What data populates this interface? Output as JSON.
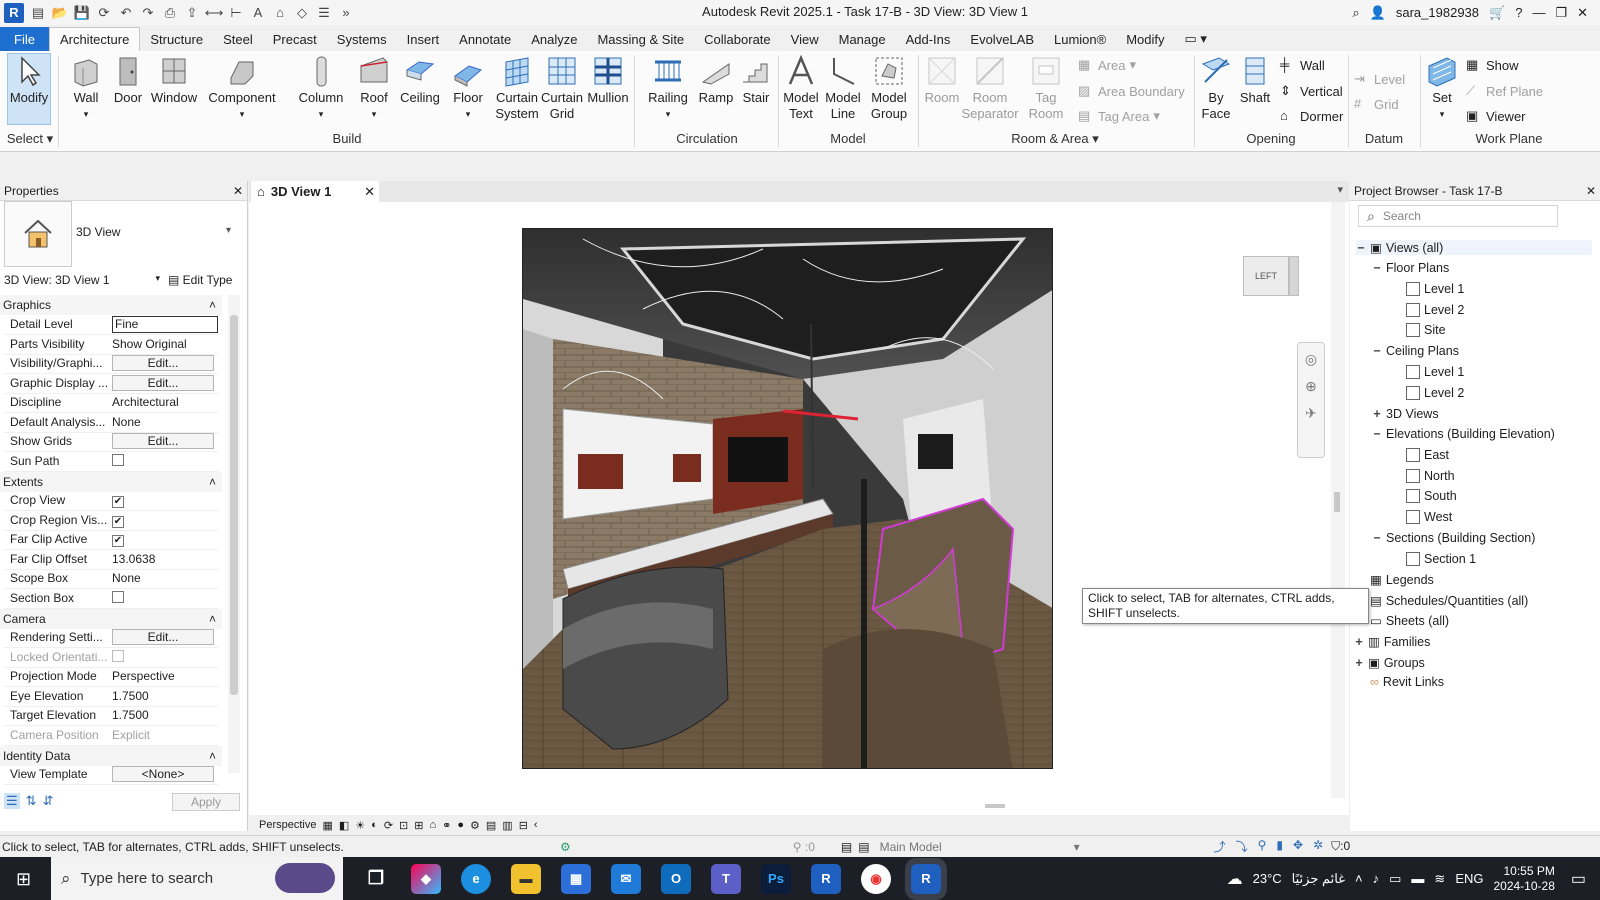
{
  "app": {
    "title": "Autodesk Revit 2025.1 - Task 17-B - 3D View: 3D View 1",
    "user": "sara_1982938"
  },
  "ribbon_tabs": [
    "File",
    "Architecture",
    "Structure",
    "Steel",
    "Precast",
    "Systems",
    "Insert",
    "Annotate",
    "Analyze",
    "Massing & Site",
    "Collaborate",
    "View",
    "Manage",
    "Add-Ins",
    "EvolveLAB",
    "Lumion®",
    "Modify"
  ],
  "ribbon": {
    "select": {
      "modify": "Modify",
      "select_label": "Select"
    },
    "build": {
      "label": "Build",
      "wall": "Wall",
      "door": "Door",
      "window": "Window",
      "component": "Component",
      "column": "Column",
      "roof": "Roof",
      "ceiling": "Ceiling",
      "floor": "Floor",
      "curtain_system": "Curtain\nSystem",
      "curtain_grid": "Curtain\nGrid",
      "mullion": "Mullion"
    },
    "circulation": {
      "label": "Circulation",
      "railing": "Railing",
      "ramp": "Ramp",
      "stair": "Stair"
    },
    "model": {
      "label": "Model",
      "model_text": "Model\nText",
      "model_line": "Model\nLine",
      "model_group": "Model\nGroup"
    },
    "room_area": {
      "label": "Room & Area",
      "room": "Room",
      "room_separator": "Room\nSeparator",
      "tag_room": "Tag\nRoom",
      "area": "Area",
      "area_boundary": "Area  Boundary",
      "tag_area": "Tag  Area"
    },
    "opening": {
      "label": "Opening",
      "by_face": "By\nFace",
      "shaft": "Shaft",
      "wall": "Wall",
      "vertical": "Vertical",
      "dormer": "Dormer"
    },
    "datum": {
      "label": "Datum",
      "level": "Level",
      "grid": "Grid"
    },
    "work_plane": {
      "label": "Work Plane",
      "set": "Set",
      "show": "Show",
      "ref_plane": "Ref  Plane",
      "viewer": "Viewer"
    }
  },
  "properties": {
    "title": "Properties",
    "type_name": "3D View",
    "instance": "3D View: 3D View 1",
    "edit_type": "Edit Type",
    "groups": {
      "graphics": "Graphics",
      "extents": "Extents",
      "camera": "Camera",
      "identity": "Identity Data"
    },
    "rows": {
      "detail_level": {
        "k": "Detail Level",
        "v": "Fine"
      },
      "parts_visibility": {
        "k": "Parts Visibility",
        "v": "Show Original"
      },
      "visibility_graphics": {
        "k": "Visibility/Graphi...",
        "v": "Edit..."
      },
      "graphic_display": {
        "k": "Graphic Display ...",
        "v": "Edit..."
      },
      "discipline": {
        "k": "Discipline",
        "v": "Architectural"
      },
      "default_analysis": {
        "k": "Default Analysis...",
        "v": "None"
      },
      "show_grids": {
        "k": "Show Grids",
        "v": "Edit..."
      },
      "sun_path": {
        "k": "Sun Path",
        "checked": false
      },
      "crop_view": {
        "k": "Crop View",
        "checked": true
      },
      "crop_region_vis": {
        "k": "Crop Region Vis...",
        "checked": true
      },
      "far_clip_active": {
        "k": "Far Clip Active",
        "checked": true
      },
      "far_clip_offset": {
        "k": "Far Clip Offset",
        "v": "13.0638"
      },
      "scope_box": {
        "k": "Scope Box",
        "v": "None"
      },
      "section_box": {
        "k": "Section Box",
        "checked": false
      },
      "rendering_settings": {
        "k": "Rendering Setti...",
        "v": "Edit..."
      },
      "locked_orientation": {
        "k": "Locked Orientati...",
        "checked": false
      },
      "projection_mode": {
        "k": "Projection Mode",
        "v": "Perspective"
      },
      "eye_elevation": {
        "k": "Eye Elevation",
        "v": "1.7500"
      },
      "target_elevation": {
        "k": "Target Elevation",
        "v": "1.7500"
      },
      "camera_position": {
        "k": "Camera Position",
        "v": "Explicit"
      },
      "view_template": {
        "k": "View Template",
        "v": "<None>"
      }
    },
    "apply": "Apply"
  },
  "view": {
    "tab": "3D View 1",
    "viewcube_face": "LEFT",
    "projection_label": "Perspective"
  },
  "browser": {
    "title": "Project Browser - Task 17-B",
    "search_placeholder": "Search",
    "views_all": "Views (all)",
    "floor_plans": "Floor Plans",
    "fp_level1": "Level 1",
    "fp_level2": "Level 2",
    "fp_site": "Site",
    "ceiling_plans": "Ceiling Plans",
    "cp_level1": "Level 1",
    "cp_level2": "Level 2",
    "views_3d": "3D Views",
    "elevations": "Elevations (Building Elevation)",
    "east": "East",
    "north": "North",
    "south": "South",
    "west": "West",
    "sections": "Sections (Building Section)",
    "section1": "Section 1",
    "legends": "Legends",
    "schedules": "Schedules/Quantities (all)",
    "sheets": "Sheets (all)",
    "families": "Families",
    "groups": "Groups",
    "revit_links": "Revit Links"
  },
  "tooltip": "Click to select, TAB for alternates, CTRL adds, SHIFT unselects.",
  "status": {
    "message": "Click to select, TAB for alternates, CTRL adds, SHIFT unselects.",
    "count": ":0",
    "model": "Main Model",
    "filter_count": ":0"
  },
  "taskbar": {
    "search_placeholder": "Type here to search",
    "temperature": "23°C",
    "weather": "غائم جزئيًا",
    "lang": "ENG",
    "time": "10:55 PM",
    "date": "2024-10-28"
  },
  "colors": {
    "file_tab": "#1f6fd1",
    "taskbar": "#1c1f26",
    "selection_magenta": "#d23ad6",
    "wall_red": "#7a2c1f"
  }
}
